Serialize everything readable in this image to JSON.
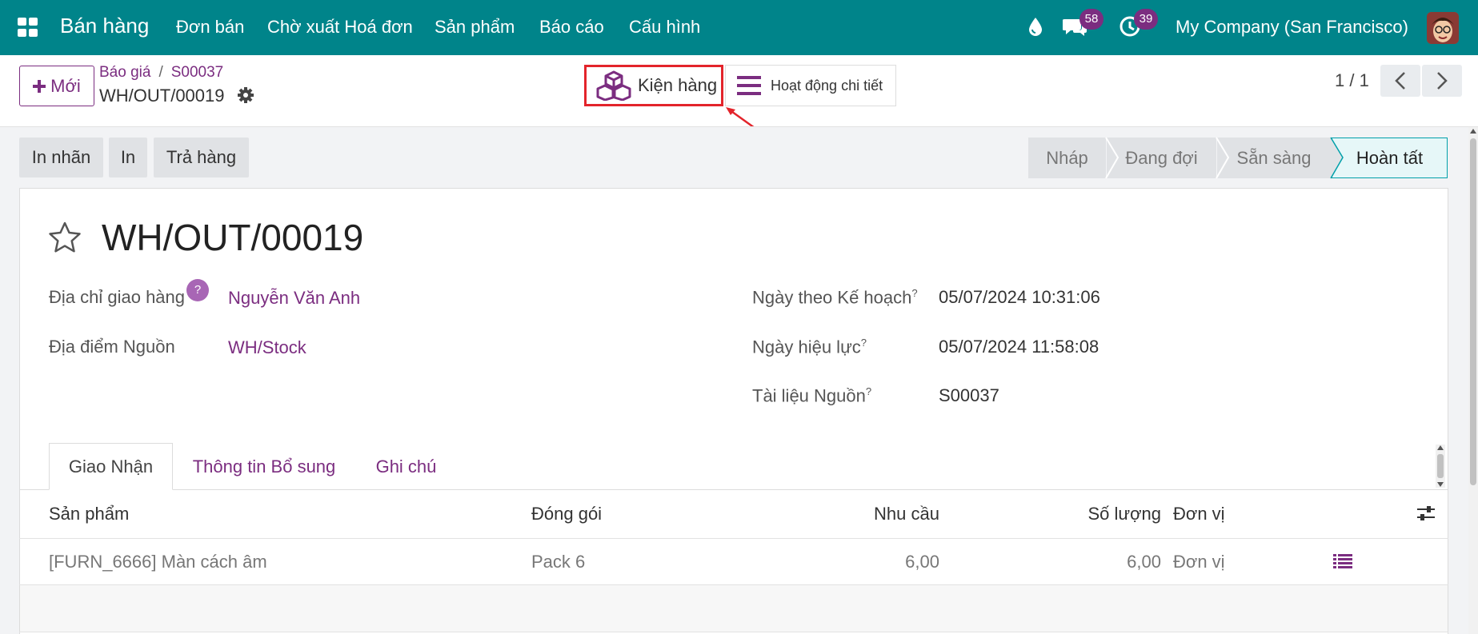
{
  "navbar": {
    "app_title": "Bán hàng",
    "menus": [
      "Đơn bán",
      "Chờ xuất Hoá đơn",
      "Sản phẩm",
      "Báo cáo",
      "Cấu hình"
    ],
    "messages_count": "58",
    "activities_count": "39",
    "company": "My Company (San Francisco)"
  },
  "control": {
    "new_label": "Mới",
    "breadcrumb": [
      "Báo giá",
      "S00037"
    ],
    "record_name": "WH/OUT/00019",
    "smart_buttons": {
      "packages": "Kiện hàng",
      "detailed_ops": "Hoạt động chi tiết"
    },
    "pager": "1 / 1"
  },
  "actions": [
    "In nhãn",
    "In",
    "Trả hàng"
  ],
  "status": {
    "stages": [
      "Nháp",
      "Đang đợi",
      "Sẵn sàng",
      "Hoàn tất"
    ],
    "active": "Hoàn tất"
  },
  "form": {
    "title": "WH/OUT/00019",
    "fields_left": [
      {
        "label": "Địa chỉ giao hàng",
        "value": "Nguyễn Văn Anh",
        "help": "?"
      },
      {
        "label": "Địa điểm Nguồn",
        "value": "WH/Stock"
      }
    ],
    "fields_right": [
      {
        "label": "Ngày theo Kế hoạch",
        "value": "05/07/2024 10:31:06"
      },
      {
        "label": "Ngày hiệu lực",
        "value": "05/07/2024 11:58:08"
      },
      {
        "label": "Tài liệu Nguồn",
        "value": "S00037"
      }
    ],
    "help_marker": "?"
  },
  "tabs": [
    "Giao Nhận",
    "Thông tin Bổ sung",
    "Ghi chú"
  ],
  "table": {
    "headers": [
      "Sản phẩm",
      "Đóng gói",
      "Nhu cầu",
      "Số lượng",
      "Đơn vị"
    ],
    "rows": [
      {
        "product": "[FURN_6666] Màn cách âm",
        "packaging": "Pack 6",
        "demand": "6,00",
        "quantity": "6,00",
        "uom": "Đơn vị"
      }
    ]
  },
  "colors": {
    "navbar": "#00848a",
    "brand": "#7b2d80",
    "highlight": "#e3242b",
    "active_stage": "#e6f7f8"
  },
  "icons": [
    "apps-grid-icon",
    "droplet-icon",
    "chat-icon",
    "clock-icon",
    "gear-icon",
    "cubes-icon",
    "list-icon",
    "star-icon",
    "chevron-left-icon",
    "chevron-right-icon",
    "sliders-icon",
    "detail-list-icon",
    "arrow-annotation"
  ]
}
